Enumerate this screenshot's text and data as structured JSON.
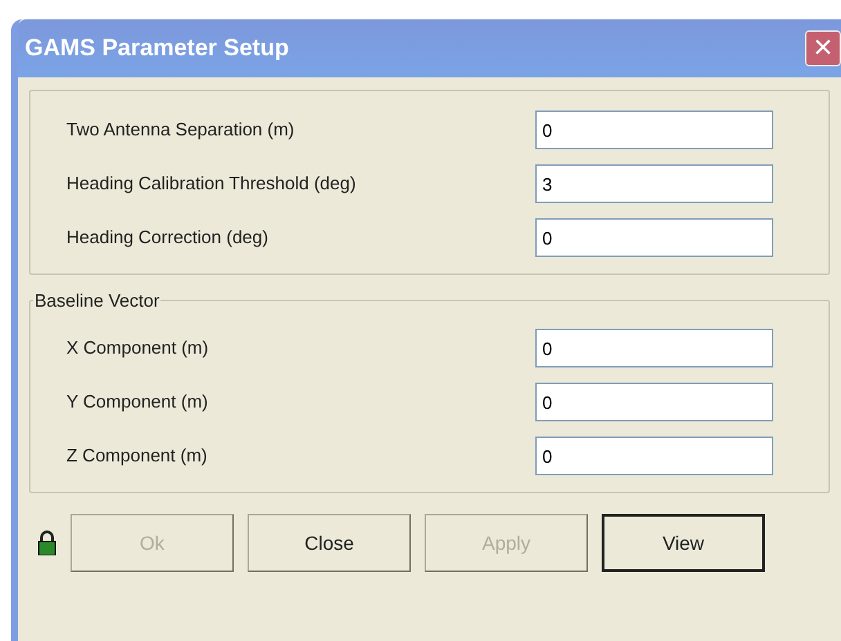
{
  "window": {
    "title": "GAMS Parameter Setup",
    "close": "×"
  },
  "general": {
    "fields": [
      {
        "label": "Two Antenna Separation (m)",
        "value": "0"
      },
      {
        "label": "Heading Calibration Threshold (deg)",
        "value": "3"
      },
      {
        "label": "Heading Correction (deg)",
        "value": "0"
      }
    ]
  },
  "baseline_vector": {
    "title": "Baseline Vector",
    "fields": [
      {
        "label": "X Component (m)",
        "value": "0"
      },
      {
        "label": "Y Component (m)",
        "value": "0"
      },
      {
        "label": "Z Component (m)",
        "value": "0"
      }
    ]
  },
  "buttons": [
    {
      "label": "Ok",
      "disabled": true,
      "default": false
    },
    {
      "label": "Close",
      "disabled": false,
      "default": false
    },
    {
      "label": "Apply",
      "disabled": true,
      "default": false
    },
    {
      "label": "View",
      "disabled": false,
      "default": true
    }
  ]
}
